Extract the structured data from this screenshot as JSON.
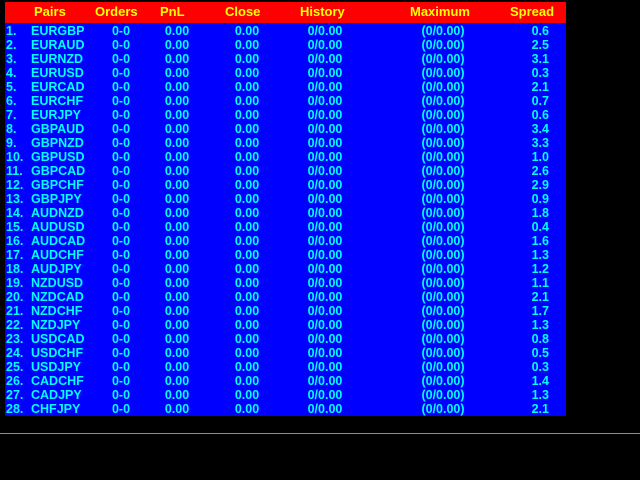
{
  "colors": {
    "background": "#000000",
    "panel": "#0000ff",
    "header": "#ff0000",
    "header_text": "#ffff00",
    "row_text": "#00ffff"
  },
  "header": {
    "pairs": "Pairs",
    "orders": "Orders",
    "pnl": "PnL",
    "close": "Close",
    "history": "History",
    "maximum": "Maximum",
    "spread": "Spread"
  },
  "rows": [
    {
      "idx": "1.",
      "pair": "EURGBP",
      "orders": "0-0",
      "pnl": "0.00",
      "close": "0.00",
      "history": "0/0.00",
      "maximum": "(0/0.00)",
      "spread": "0.6"
    },
    {
      "idx": "2.",
      "pair": "EURAUD",
      "orders": "0-0",
      "pnl": "0.00",
      "close": "0.00",
      "history": "0/0.00",
      "maximum": "(0/0.00)",
      "spread": "2.5"
    },
    {
      "idx": "3.",
      "pair": "EURNZD",
      "orders": "0-0",
      "pnl": "0.00",
      "close": "0.00",
      "history": "0/0.00",
      "maximum": "(0/0.00)",
      "spread": "3.1"
    },
    {
      "idx": "4.",
      "pair": "EURUSD",
      "orders": "0-0",
      "pnl": "0.00",
      "close": "0.00",
      "history": "0/0.00",
      "maximum": "(0/0.00)",
      "spread": "0.3"
    },
    {
      "idx": "5.",
      "pair": "EURCAD",
      "orders": "0-0",
      "pnl": "0.00",
      "close": "0.00",
      "history": "0/0.00",
      "maximum": "(0/0.00)",
      "spread": "2.1"
    },
    {
      "idx": "6.",
      "pair": "EURCHF",
      "orders": "0-0",
      "pnl": "0.00",
      "close": "0.00",
      "history": "0/0.00",
      "maximum": "(0/0.00)",
      "spread": "0.7"
    },
    {
      "idx": "7.",
      "pair": "EURJPY",
      "orders": "0-0",
      "pnl": "0.00",
      "close": "0.00",
      "history": "0/0.00",
      "maximum": "(0/0.00)",
      "spread": "0.6"
    },
    {
      "idx": "8.",
      "pair": "GBPAUD",
      "orders": "0-0",
      "pnl": "0.00",
      "close": "0.00",
      "history": "0/0.00",
      "maximum": "(0/0.00)",
      "spread": "3.4"
    },
    {
      "idx": "9.",
      "pair": "GBPNZD",
      "orders": "0-0",
      "pnl": "0.00",
      "close": "0.00",
      "history": "0/0.00",
      "maximum": "(0/0.00)",
      "spread": "3.3"
    },
    {
      "idx": "10.",
      "pair": "GBPUSD",
      "orders": "0-0",
      "pnl": "0.00",
      "close": "0.00",
      "history": "0/0.00",
      "maximum": "(0/0.00)",
      "spread": "1.0"
    },
    {
      "idx": "11.",
      "pair": "GBPCAD",
      "orders": "0-0",
      "pnl": "0.00",
      "close": "0.00",
      "history": "0/0.00",
      "maximum": "(0/0.00)",
      "spread": "2.6"
    },
    {
      "idx": "12.",
      "pair": "GBPCHF",
      "orders": "0-0",
      "pnl": "0.00",
      "close": "0.00",
      "history": "0/0.00",
      "maximum": "(0/0.00)",
      "spread": "2.9"
    },
    {
      "idx": "13.",
      "pair": "GBPJPY",
      "orders": "0-0",
      "pnl": "0.00",
      "close": "0.00",
      "history": "0/0.00",
      "maximum": "(0/0.00)",
      "spread": "0.9"
    },
    {
      "idx": "14.",
      "pair": "AUDNZD",
      "orders": "0-0",
      "pnl": "0.00",
      "close": "0.00",
      "history": "0/0.00",
      "maximum": "(0/0.00)",
      "spread": "1.8"
    },
    {
      "idx": "15.",
      "pair": "AUDUSD",
      "orders": "0-0",
      "pnl": "0.00",
      "close": "0.00",
      "history": "0/0.00",
      "maximum": "(0/0.00)",
      "spread": "0.4"
    },
    {
      "idx": "16.",
      "pair": "AUDCAD",
      "orders": "0-0",
      "pnl": "0.00",
      "close": "0.00",
      "history": "0/0.00",
      "maximum": "(0/0.00)",
      "spread": "1.6"
    },
    {
      "idx": "17.",
      "pair": "AUDCHF",
      "orders": "0-0",
      "pnl": "0.00",
      "close": "0.00",
      "history": "0/0.00",
      "maximum": "(0/0.00)",
      "spread": "1.3"
    },
    {
      "idx": "18.",
      "pair": "AUDJPY",
      "orders": "0-0",
      "pnl": "0.00",
      "close": "0.00",
      "history": "0/0.00",
      "maximum": "(0/0.00)",
      "spread": "1.2"
    },
    {
      "idx": "19.",
      "pair": "NZDUSD",
      "orders": "0-0",
      "pnl": "0.00",
      "close": "0.00",
      "history": "0/0.00",
      "maximum": "(0/0.00)",
      "spread": "1.1"
    },
    {
      "idx": "20.",
      "pair": "NZDCAD",
      "orders": "0-0",
      "pnl": "0.00",
      "close": "0.00",
      "history": "0/0.00",
      "maximum": "(0/0.00)",
      "spread": "2.1"
    },
    {
      "idx": "21.",
      "pair": "NZDCHF",
      "orders": "0-0",
      "pnl": "0.00",
      "close": "0.00",
      "history": "0/0.00",
      "maximum": "(0/0.00)",
      "spread": "1.7"
    },
    {
      "idx": "22.",
      "pair": "NZDJPY",
      "orders": "0-0",
      "pnl": "0.00",
      "close": "0.00",
      "history": "0/0.00",
      "maximum": "(0/0.00)",
      "spread": "1.3"
    },
    {
      "idx": "23.",
      "pair": "USDCAD",
      "orders": "0-0",
      "pnl": "0.00",
      "close": "0.00",
      "history": "0/0.00",
      "maximum": "(0/0.00)",
      "spread": "0.8"
    },
    {
      "idx": "24.",
      "pair": "USDCHF",
      "orders": "0-0",
      "pnl": "0.00",
      "close": "0.00",
      "history": "0/0.00",
      "maximum": "(0/0.00)",
      "spread": "0.5"
    },
    {
      "idx": "25.",
      "pair": "USDJPY",
      "orders": "0-0",
      "pnl": "0.00",
      "close": "0.00",
      "history": "0/0.00",
      "maximum": "(0/0.00)",
      "spread": "0.3"
    },
    {
      "idx": "26.",
      "pair": "CADCHF",
      "orders": "0-0",
      "pnl": "0.00",
      "close": "0.00",
      "history": "0/0.00",
      "maximum": "(0/0.00)",
      "spread": "1.4"
    },
    {
      "idx": "27.",
      "pair": "CADJPY",
      "orders": "0-0",
      "pnl": "0.00",
      "close": "0.00",
      "history": "0/0.00",
      "maximum": "(0/0.00)",
      "spread": "1.3"
    },
    {
      "idx": "28.",
      "pair": "CHFJPY",
      "orders": "0-0",
      "pnl": "0.00",
      "close": "0.00",
      "history": "0/0.00",
      "maximum": "(0/0.00)",
      "spread": "2.1"
    }
  ]
}
